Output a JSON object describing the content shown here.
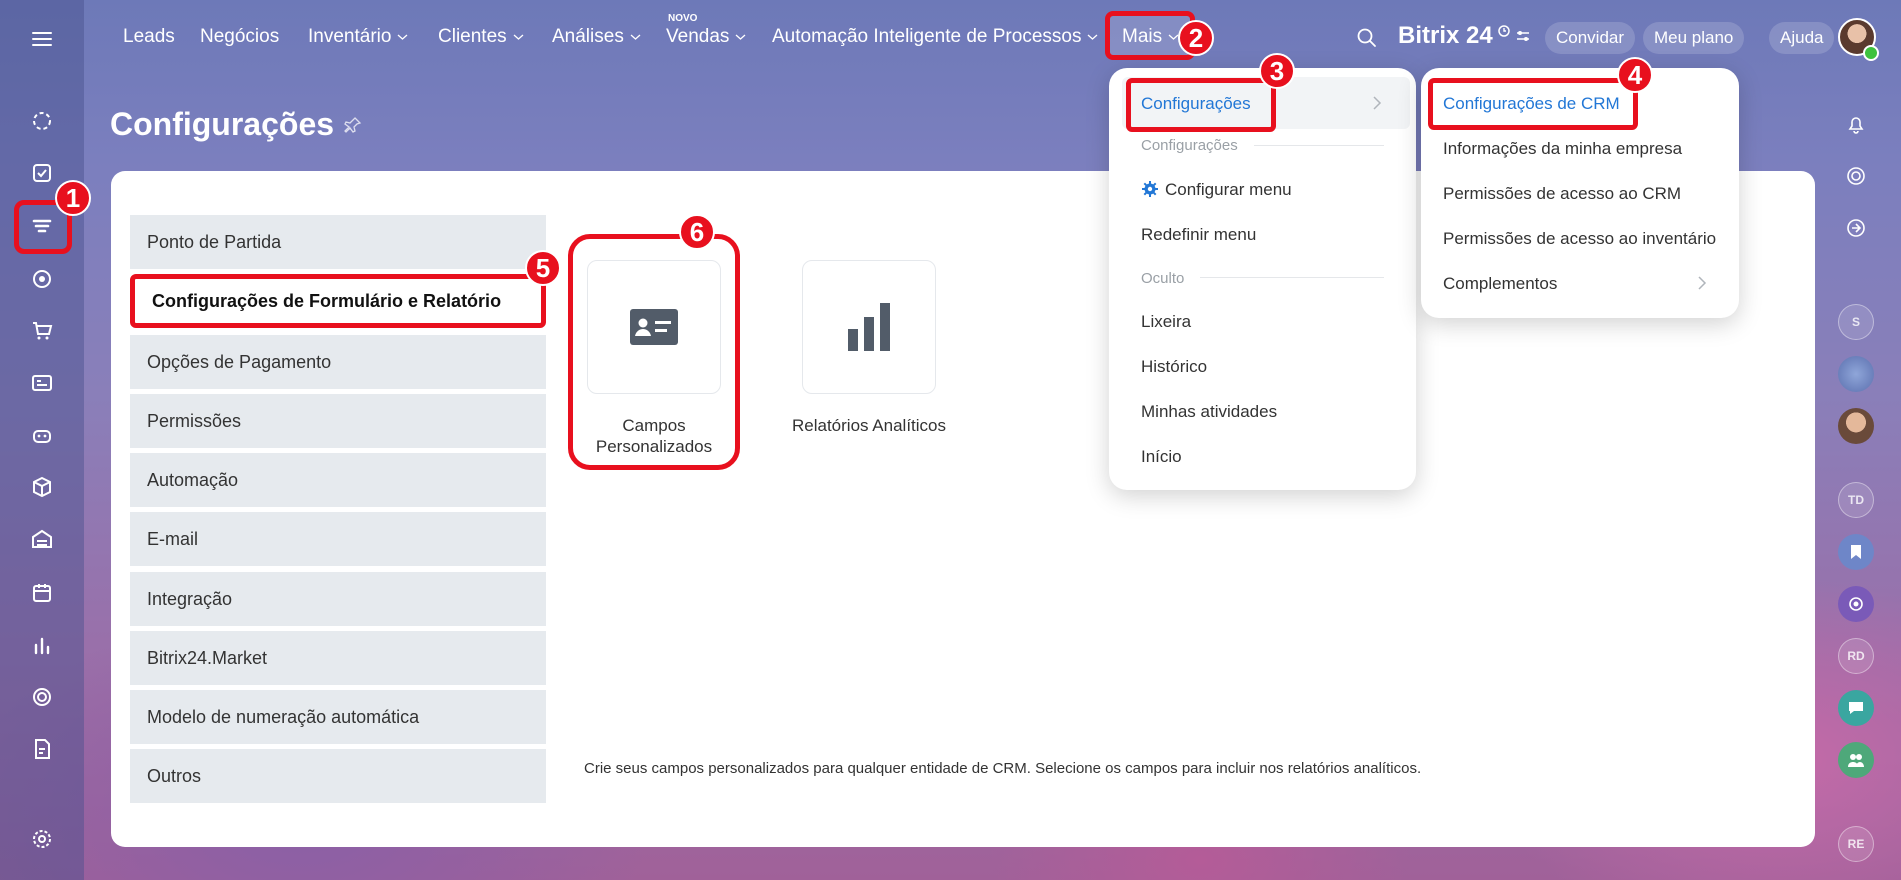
{
  "topbar": {
    "nav": [
      {
        "label": "Leads",
        "has_chevron": false
      },
      {
        "label": "Negócios",
        "has_chevron": false
      },
      {
        "label": "Inventário",
        "has_chevron": true
      },
      {
        "label": "Clientes",
        "has_chevron": true
      },
      {
        "label": "Análises",
        "has_chevron": true
      },
      {
        "label": "Vendas",
        "has_chevron": true
      },
      {
        "label": "Automação Inteligente de Processos",
        "has_chevron": true
      },
      {
        "label": "Mais",
        "has_chevron": true
      }
    ],
    "vendas_badge": "NOVO",
    "brand": "Bitrix 24",
    "invite_label": "Convidar",
    "plan_label": "Meu plano",
    "help_label": "Ajuda"
  },
  "page": {
    "title": "Configurações"
  },
  "settings_menu": [
    {
      "label": "Ponto de Partida",
      "active": false
    },
    {
      "label": "Configurações de Formulário e Relatório",
      "active": true
    },
    {
      "label": "Opções de Pagamento",
      "active": false
    },
    {
      "label": "Permissões",
      "active": false
    },
    {
      "label": "Automação",
      "active": false
    },
    {
      "label": "E-mail",
      "active": false
    },
    {
      "label": "Integração",
      "active": false
    },
    {
      "label": "Bitrix24.Market",
      "active": false
    },
    {
      "label": "Modelo de numeração automática",
      "active": false
    },
    {
      "label": "Outros",
      "active": false
    }
  ],
  "tiles": [
    {
      "label_line1": "Campos",
      "label_line2": "Personalizados",
      "icon": "id-card-icon"
    },
    {
      "label_line1": "Relatórios Analíticos",
      "label_line2": "",
      "icon": "bar-chart-icon"
    }
  ],
  "description": "Crie seus campos personalizados para qualquer entidade de CRM. Selecione os campos para incluir nos relatórios analíticos.",
  "mais_dropdown": {
    "selected": "Configurações",
    "section_settings": "Configurações",
    "configure_menu": "Configurar menu",
    "reset_menu": "Redefinir menu",
    "section_hidden": "Oculto",
    "hidden_items": [
      "Lixeira",
      "Histórico",
      "Minhas atividades",
      "Início"
    ]
  },
  "config_submenu": [
    {
      "label": "Configurações de CRM",
      "highlighted": true
    },
    {
      "label": "Informações da minha empresa",
      "highlighted": false
    },
    {
      "label": "Permissões de acesso ao CRM",
      "highlighted": false
    },
    {
      "label": "Permissões de acesso ao inventário",
      "highlighted": false
    },
    {
      "label": "Complementos",
      "highlighted": false,
      "has_arrow": true
    }
  ],
  "step_badges": [
    "1",
    "2",
    "3",
    "4",
    "5",
    "6"
  ],
  "right_rail_initials": [
    "S",
    "TD",
    "RD",
    "RE"
  ],
  "colors": {
    "accent": "#2067b0",
    "highlight": "#e8101e",
    "link": "#2277d6"
  }
}
